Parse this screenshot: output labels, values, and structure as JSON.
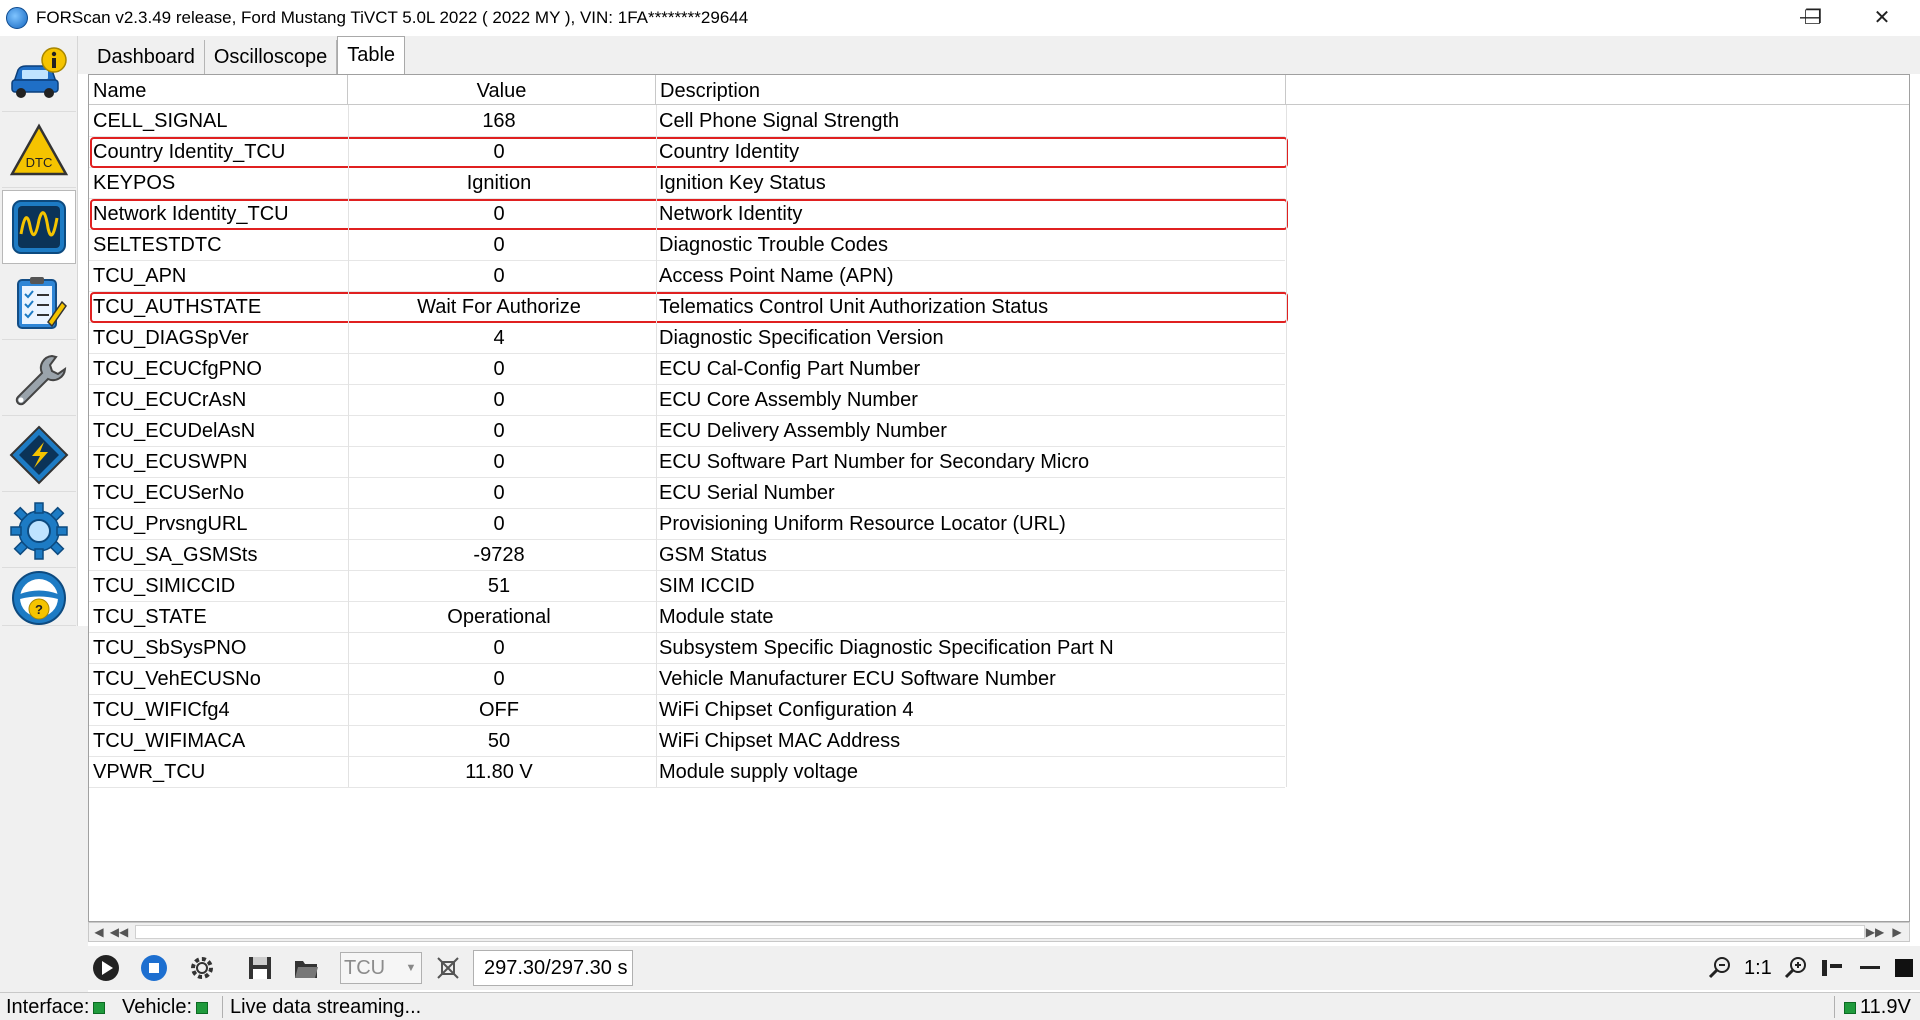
{
  "window": {
    "title": "FORScan v2.3.49 release, Ford Mustang TiVCT 5.0L 2022 ( 2022 MY ), VIN: 1FA********29644",
    "minimize": "—",
    "maximize": "❐",
    "close": "✕"
  },
  "sidebar": {
    "items": [
      {
        "name": "vehicle-info",
        "icon": "car-info-icon"
      },
      {
        "name": "dtc",
        "icon": "dtc-warning-icon",
        "label": "DTC"
      },
      {
        "name": "oscilloscope",
        "icon": "oscilloscope-icon"
      },
      {
        "name": "tests",
        "icon": "checklist-icon"
      },
      {
        "name": "service",
        "icon": "wrench-icon"
      },
      {
        "name": "configuration",
        "icon": "chip-icon"
      },
      {
        "name": "settings",
        "icon": "gear-icon"
      },
      {
        "name": "help",
        "icon": "help-icon",
        "label": "?"
      }
    ]
  },
  "tabs": [
    {
      "label": "Dashboard"
    },
    {
      "label": "Oscilloscope"
    },
    {
      "label": "Table"
    }
  ],
  "table": {
    "columns": [
      "Name",
      "Value",
      "Description"
    ],
    "rows": [
      {
        "name": "CELL_SIGNAL",
        "value": "168",
        "description": "Cell Phone Signal Strength"
      },
      {
        "name": "Country Identity_TCU",
        "value": "0",
        "description": "Country Identity"
      },
      {
        "name": "KEYPOS",
        "value": "Ignition",
        "description": "Ignition Key Status"
      },
      {
        "name": "Network Identity_TCU",
        "value": "0",
        "description": "Network Identity"
      },
      {
        "name": "SELTESTDTC",
        "value": "0",
        "description": "Diagnostic Trouble Codes"
      },
      {
        "name": "TCU_APN",
        "value": "0",
        "description": "Access Point Name (APN)"
      },
      {
        "name": "TCU_AUTHSTATE",
        "value": "Wait For Authorize",
        "description": "Telematics Control Unit Authorization Status"
      },
      {
        "name": "TCU_DIAGSpVer",
        "value": "4",
        "description": "Diagnostic Specification Version"
      },
      {
        "name": "TCU_ECUCfgPNO",
        "value": "0",
        "description": "ECU Cal-Config Part Number"
      },
      {
        "name": "TCU_ECUCrAsN",
        "value": "0",
        "description": "ECU Core Assembly Number"
      },
      {
        "name": "TCU_ECUDelAsN",
        "value": "0",
        "description": "ECU Delivery Assembly Number"
      },
      {
        "name": "TCU_ECUSWPN",
        "value": "0",
        "description": "ECU Software Part Number for Secondary Micro"
      },
      {
        "name": "TCU_ECUSerNo",
        "value": "0",
        "description": "ECU Serial Number"
      },
      {
        "name": "TCU_PrvsngURL",
        "value": "0",
        "description": "Provisioning Uniform Resource Locator (URL)"
      },
      {
        "name": "TCU_SA_GSMSts",
        "value": "-9728",
        "description": "GSM Status"
      },
      {
        "name": "TCU_SIMICCID",
        "value": "51",
        "description": "SIM ICCID"
      },
      {
        "name": "TCU_STATE",
        "value": "Operational",
        "description": "Module state"
      },
      {
        "name": "TCU_SbSysPNO",
        "value": "0",
        "description": "Subsystem Specific Diagnostic Specification Part N"
      },
      {
        "name": "TCU_VehECUSNo",
        "value": "0",
        "description": "Vehicle Manufacturer ECU Software Number"
      },
      {
        "name": "TCU_WIFICfg4",
        "value": "OFF",
        "description": "WiFi Chipset Configuration 4"
      },
      {
        "name": "TCU_WIFIMACA",
        "value": "50",
        "description": "WiFi Chipset MAC Address"
      },
      {
        "name": "VPWR_TCU",
        "value": "11.80 V",
        "description": "Module supply voltage"
      }
    ],
    "highlight_color": "#e02020"
  },
  "toolbar": {
    "module_select": "TCU",
    "time": "297.30/297.30 s",
    "ratio": "1:1"
  },
  "status": {
    "interface_label": "Interface:",
    "vehicle_label": "Vehicle:",
    "message": "Live data streaming...",
    "voltage": "11.9V",
    "led_color": "#1f9a3c"
  }
}
